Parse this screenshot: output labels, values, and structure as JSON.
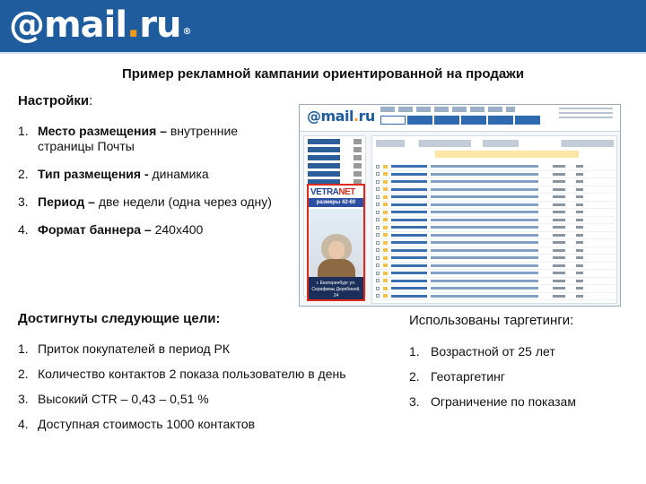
{
  "header": {
    "logo_prefix": "@",
    "logo_mail": "mail",
    "logo_dot": ".",
    "logo_ru": "ru",
    "logo_reg": "®",
    "color_bar": "#1f5c9e",
    "color_accent": "#f39a19"
  },
  "title": "Пример рекламной кампании ориентированной на продажи",
  "settings": {
    "heading": "Настройки",
    "heading_suffix": ":",
    "items": [
      {
        "num": "1.",
        "label": "Место размещения –",
        "value": " внутренние страницы Почты"
      },
      {
        "num": "2.",
        "label": "Тип размещения -",
        "value": " динамика"
      },
      {
        "num": "3.",
        "label": "Период –",
        "value": " две недели (одна через одну)"
      },
      {
        "num": "4.",
        "label": "Формат баннера –",
        "value": " 240х400"
      }
    ]
  },
  "screenshot": {
    "logo_mail": "mail",
    "logo_dot": ".",
    "logo_ru": "ru",
    "banner_brand_a": "VETRA",
    "banner_brand_b": "NET",
    "banner_sizes": "размеры 42-60",
    "banner_footer": "г. Екатеринбург ул. Серафимы Дерябиной, 24",
    "banner_border_color": "#e0281f"
  },
  "goals": {
    "heading": "Достигнуты следующие цели:",
    "items": [
      {
        "num": "1.",
        "text": "Приток покупателей в период РК"
      },
      {
        "num": "2.",
        "text": "Количество контактов 2 показа пользователю в день"
      },
      {
        "num": "3.",
        "text": "Высокий CTR – 0,43 – 0,51 %"
      },
      {
        "num": "4.",
        "text": "Доступная стоимость 1000 контактов"
      }
    ]
  },
  "targeting": {
    "heading": "Использованы таргетинги:",
    "items": [
      {
        "num": "1.",
        "text": "Возрастной от 25 лет"
      },
      {
        "num": "2.",
        "text": "Геотаргетинг"
      },
      {
        "num": "3.",
        "text": "Ограничение по показам"
      }
    ]
  }
}
